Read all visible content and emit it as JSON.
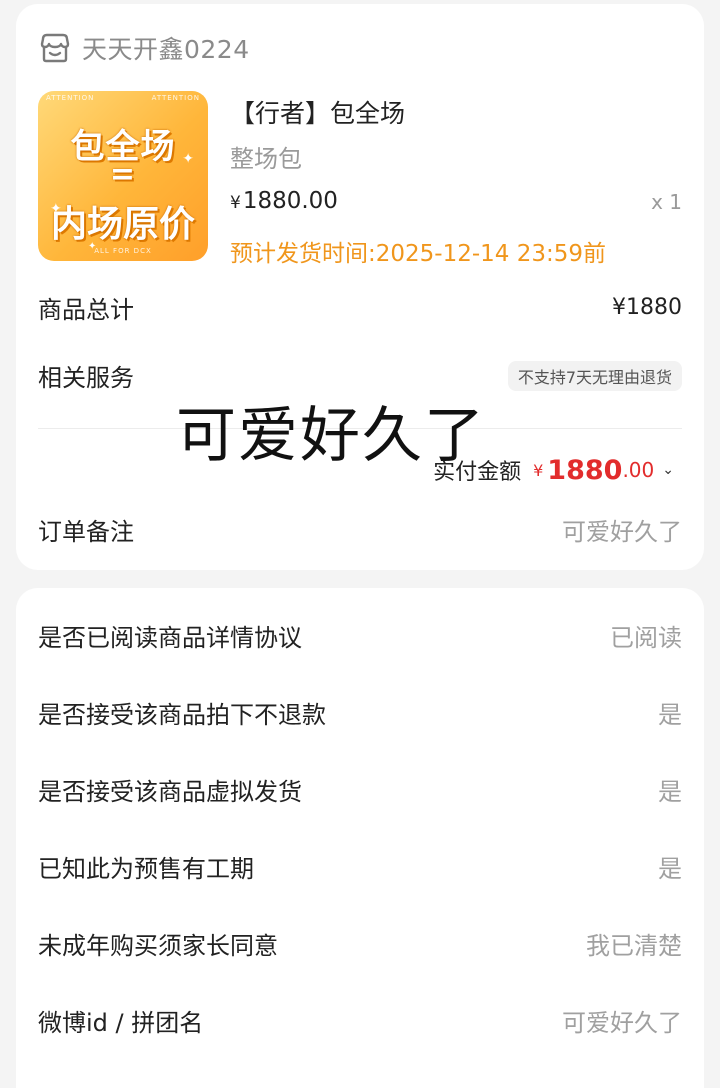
{
  "shop": {
    "name": "天天开鑫0224",
    "icon": "shop-icon"
  },
  "product": {
    "thumb_top_left": "ATTENTION",
    "thumb_top_right": "ATTENTION",
    "thumb_line1": "包全场",
    "thumb_line2": "=",
    "thumb_line3": "内场原价",
    "thumb_bottom": "ALL FOR DCX",
    "title": "【行者】包全场",
    "subtitle": "整场包",
    "currency": "¥",
    "price": "1880.00",
    "quantity": "x 1",
    "shipping": "预计发货时间:2025-12-14 23:59前"
  },
  "summary": {
    "total_label": "商品总计",
    "total_value": "¥1880",
    "service_label": "相关服务",
    "service_tag": "不支持7天无理由退货",
    "overlay": "可爱好久了",
    "paid_label": "实付金额",
    "paid_currency": "¥",
    "paid_int": "1880",
    "paid_dec": ".00",
    "note_label": "订单备注",
    "note_value": "可爱好久了"
  },
  "questions": [
    {
      "label": "是否已阅读商品详情协议",
      "value": "已阅读"
    },
    {
      "label": "是否接受该商品拍下不退款",
      "value": "是"
    },
    {
      "label": "是否接受该商品虚拟发货",
      "value": "是"
    },
    {
      "label": "已知此为预售有工期",
      "value": "是"
    },
    {
      "label": "未成年购买须家长同意",
      "value": "我已清楚"
    },
    {
      "label": "微博id / 拼团名",
      "value": "可爱好久了"
    }
  ],
  "colors": {
    "accent_red": "#e22c2c",
    "shipping_orange": "#f0961c"
  }
}
